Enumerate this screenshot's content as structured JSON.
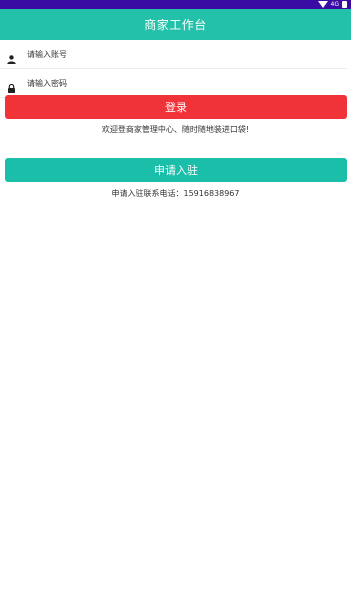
{
  "status_bar": {
    "signal_label": "4G",
    "background": "#3a0ca3",
    "icons": [
      "wifi-icon",
      "battery-icon"
    ]
  },
  "header": {
    "title": "商家工作台",
    "background": "#24c1aa"
  },
  "form": {
    "account": {
      "placeholder": "请输入账号",
      "value": "",
      "icon": "user-icon"
    },
    "password": {
      "placeholder": "请输入密码",
      "value": "",
      "icon": "lock-icon"
    }
  },
  "buttons": {
    "login_label": "登录",
    "login_color": "#ef3338",
    "apply_label": "申请入驻",
    "apply_color": "#1bbfa9"
  },
  "messages": {
    "welcome": "欢迎登商家管理中心、随时随地装进口袋!",
    "contact": "申请入驻联系电话：15916838967"
  }
}
